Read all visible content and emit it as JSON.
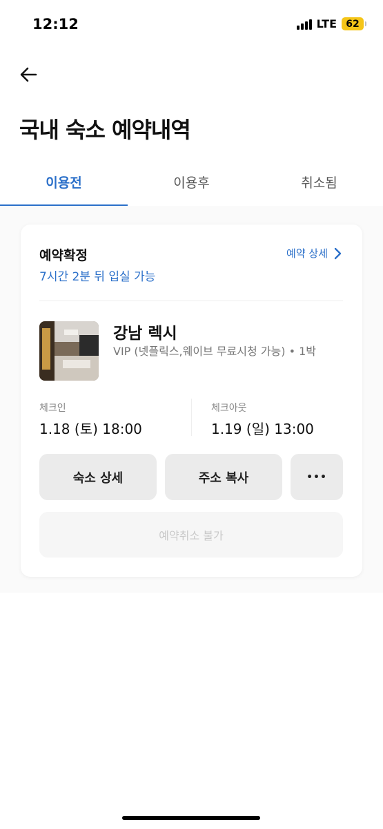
{
  "status_bar": {
    "time": "12:12",
    "network": "LTE",
    "battery": "62",
    "icons": [
      "signal-icon",
      "battery-icon"
    ]
  },
  "header": {
    "back_icon": "back-arrow-icon",
    "title": "국내 숙소 예약내역"
  },
  "tabs": [
    {
      "label": "이용전",
      "active": true
    },
    {
      "label": "이용후",
      "active": false
    },
    {
      "label": "취소됨",
      "active": false
    }
  ],
  "reservation": {
    "status": "예약확정",
    "checkin_notice": "7시간 2분 뒤 입실 가능",
    "detail_link": "예약 상세",
    "hotel_name": "강남 렉시",
    "room_info": "VIP (넷플릭스,웨이브 무료시청 가능) • 1박",
    "checkin_label": "체크인",
    "checkin_value": "1.18 (토) 18:00",
    "checkout_label": "체크아웃",
    "checkout_value": "1.19 (일) 13:00",
    "buttons": {
      "hotel_detail": "숙소 상세",
      "copy_address": "주소 복사",
      "more": "•••",
      "cancel": "예약취소 불가"
    }
  },
  "colors": {
    "accent": "#2a6fc9",
    "battery": "#f5c518",
    "button_bg": "#ebebeb"
  }
}
